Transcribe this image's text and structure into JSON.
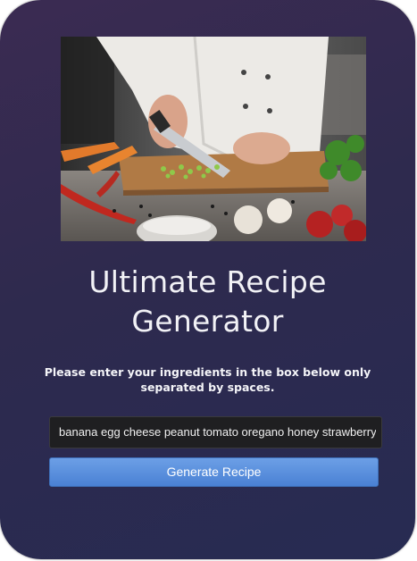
{
  "app": {
    "title": "Ultimate Recipe Generator",
    "instructions": "Please enter your ingredients in the box below only separated by spaces."
  },
  "form": {
    "ingredients_value": "banana egg cheese peanut tomato oregano honey strawberry ham",
    "submit_label": "Generate Recipe"
  },
  "colors": {
    "card_background": "#2e2a4e",
    "button": "#5a8fdc",
    "input_background": "#1f1f21"
  },
  "image": {
    "subject": "chef chopping herbs on a cutting board with vegetables"
  }
}
